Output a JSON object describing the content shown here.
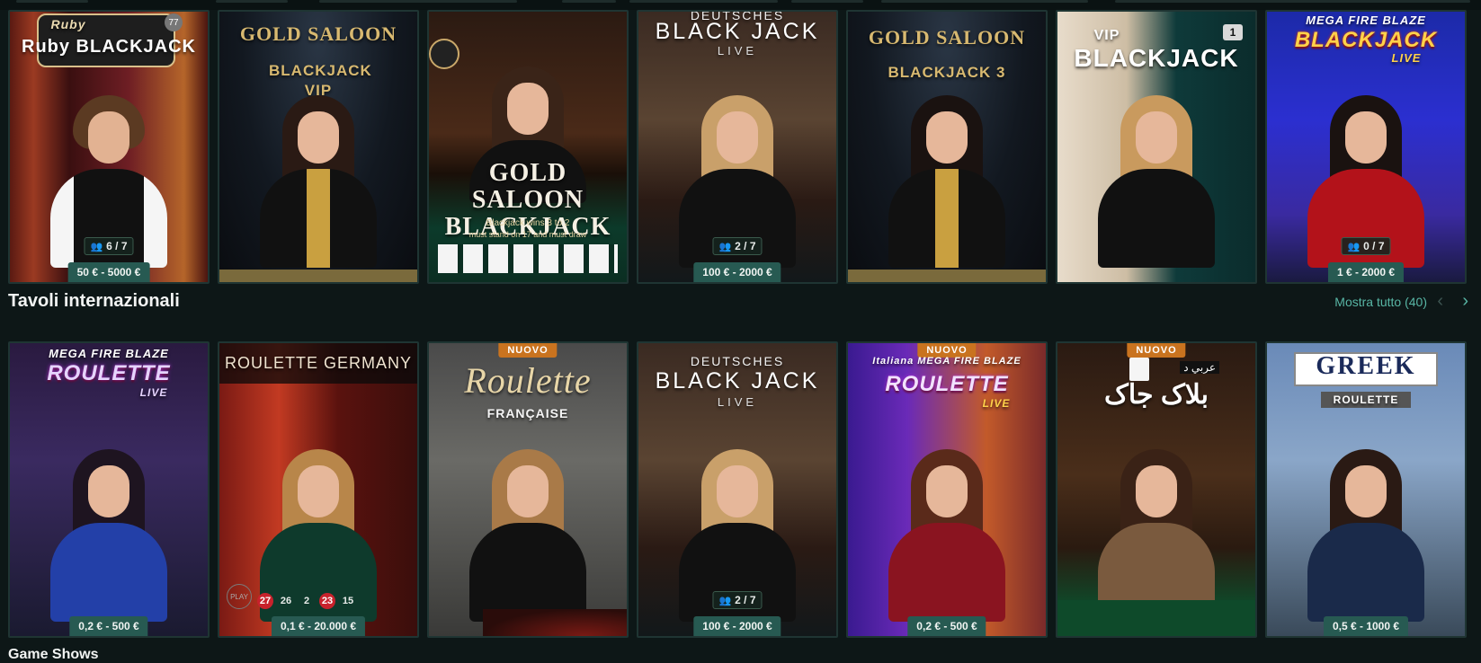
{
  "row1": [
    {
      "title": "Ruby BLACKJACK",
      "badge_num": "77",
      "seats": "6 / 7",
      "limit": "50 € - 5000 €"
    },
    {
      "title_top": "GOLD SALOON",
      "title_sub": "BLACKJACK VIP",
      "limit": ""
    },
    {
      "title": "GOLD SALOON BLACKJACK",
      "small_text": "Blackjack wins 3 to 2",
      "small_text2": "must stand on 17 and must draw",
      "limit": ""
    },
    {
      "title_top": "DEUTSCHES",
      "title_mid": "BLACK JACK",
      "title_sub": "LIVE",
      "seats": "2 / 7",
      "limit": "100 € - 2000 €"
    },
    {
      "title_top": "GOLD SALOON",
      "title_sub": "BLACKJACK 3",
      "limit": ""
    },
    {
      "title_top": "VIP",
      "title_mid": "BLACKJACK",
      "badge_num": "1",
      "limit": ""
    },
    {
      "title_top": "MEGA FIRE BLAZE",
      "title_mid": "BLACKJACK",
      "title_sub": "LIVE",
      "seats": "0 / 7",
      "limit": "1 € - 2000 €"
    }
  ],
  "section": {
    "title": "Tavoli internazionali",
    "show_all": "Mostra tutto (40)",
    "prev_icon": "chevron-left-icon",
    "next_icon": "chevron-right-icon"
  },
  "row2": [
    {
      "title_top": "MEGA FIRE BLAZE",
      "title_mid": "ROULETTE",
      "title_sub": "LIVE",
      "limit": "0,2 € - 500 €"
    },
    {
      "title_top": "ROULETTE GERMANY",
      "numbers": [
        "27",
        "26",
        "2",
        "23",
        "15"
      ],
      "play": "PLAY",
      "limit": "0,1 € - 20.000 €"
    },
    {
      "badge": "NUOVO",
      "title_mid": "Roulette",
      "title_sub": "FRANÇAISE",
      "limit": ""
    },
    {
      "title_top": "DEUTSCHES",
      "title_mid": "BLACK JACK",
      "title_sub": "LIVE",
      "seats": "2 / 7",
      "limit": "100 € - 2000 €"
    },
    {
      "badge": "NUOVO",
      "title_top": "Italiana MEGA FIRE BLAZE",
      "title_mid": "ROULETTE",
      "title_sub": "LIVE",
      "limit": "0,2 € - 500 €"
    },
    {
      "badge": "NUOVO",
      "title_top": "عربي د",
      "title_mid": "بلاک جاک",
      "limit": ""
    },
    {
      "title_top": "GREEK",
      "title_sub": "ROULETTE",
      "limit": "0,5 € - 1000 €"
    }
  ],
  "bottom_section": {
    "title": "Game Shows"
  },
  "colors": {
    "accent": "#58b6a5",
    "price_bg": "#275a52",
    "bg": "#0d1717",
    "badge": "#c9731f"
  }
}
